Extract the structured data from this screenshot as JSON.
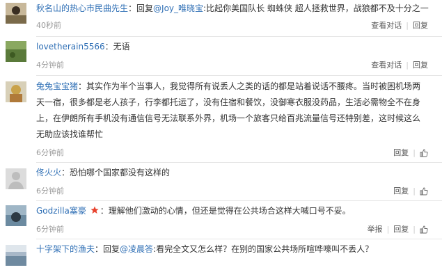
{
  "comments": [
    {
      "name": "秋名山的热心市民曲先生",
      "sep": "：",
      "reply_prefix": "回复",
      "reply_to": "@Joy_唯晓宝",
      "text": ":比起你美国队长 蜘蛛侠 超人拯救世界，战狼都不及十分之一",
      "time": "40秒前",
      "action1": "查看对话",
      "action2": "回复"
    },
    {
      "name": "lovetherain5566",
      "text": "：无语",
      "time": "4分钟前",
      "action1": "查看对话",
      "action2": "回复"
    },
    {
      "name": "兔兔宝宝猪",
      "text_lines": [
        "：其实作为半个当事人，我觉得所有说丢人之类的话的都是站着说话不腰疼。当时被困机场两",
        "天一宿，很多都是老人孩子，行李都托运了，没有住宿和餐饮，没御寒衣服没药品，生活必需物全不在身",
        "上，在伊朗所有手机没有通信信号无法联系外界，机场一个旅客只给百兆流量信号还特别差，这时候这么",
        "无助应该找谁帮忙"
      ],
      "time": "6分钟前",
      "action1": "回复"
    },
    {
      "name": "佟火火",
      "text": "：恐怕哪个国家都没有这样的",
      "time": "6分钟前",
      "action1": "回复"
    },
    {
      "name": "Godzilla塞豪",
      "text": "：理解他们激动的心情，但还是觉得在公共场合这样大喊口号不妥。",
      "time": "6分钟前",
      "action1": "举报",
      "action2": "回复"
    },
    {
      "name": "十字架下的渔夫",
      "sep": "：",
      "reply_prefix": "回复",
      "reply_to": "@凌晨答",
      "text": ":看完全文又怎么样？在别的国家公共场所喧哗嚎叫不丢人？"
    }
  ],
  "icons": {
    "like": "thumbs-up-icon",
    "medal": "star-badge-icon"
  },
  "colors": {
    "link": "#2f6fb5",
    "meta": "#999999",
    "medal": "#e8432e"
  }
}
